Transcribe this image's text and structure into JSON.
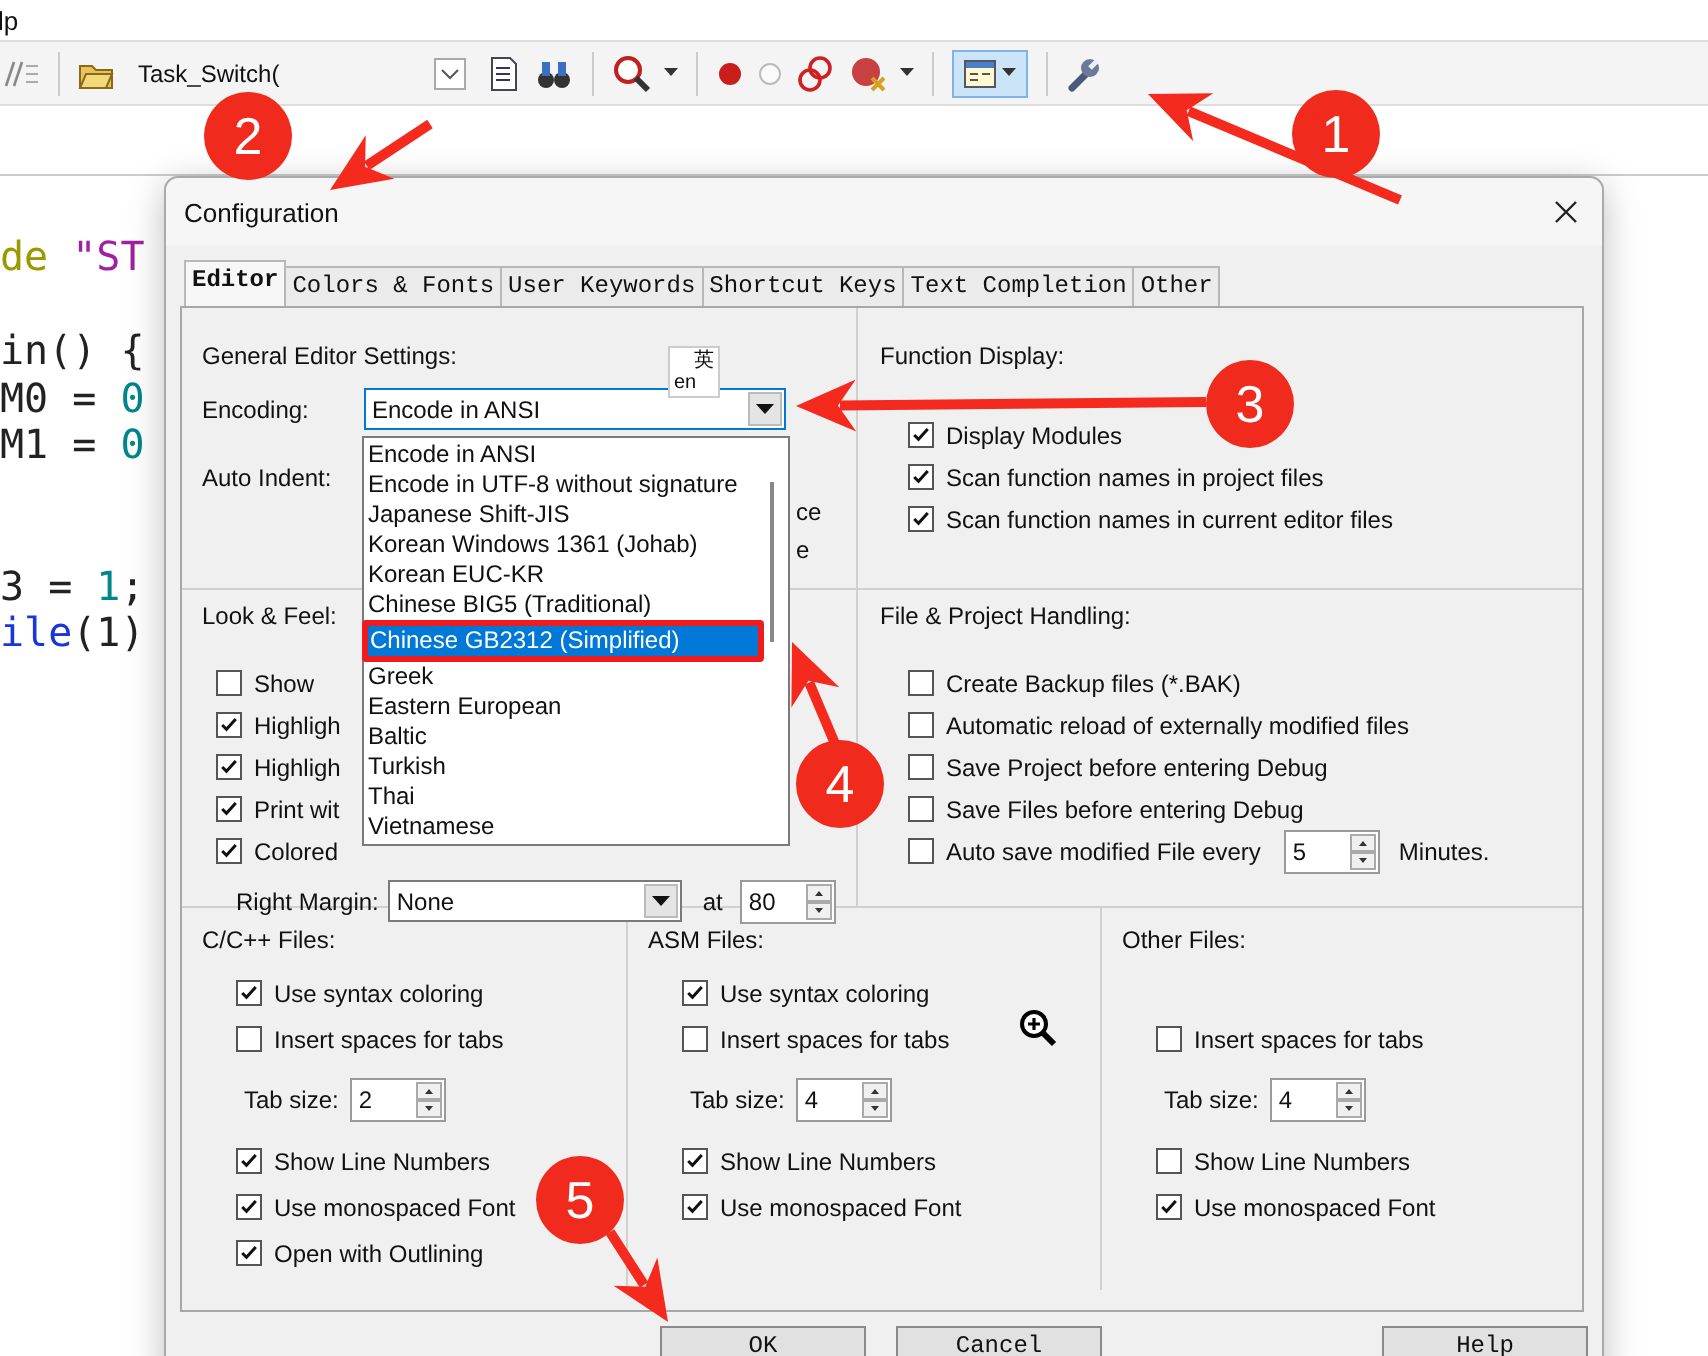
{
  "menu_bar": {
    "text": "lp"
  },
  "toolbar": {
    "target_combo": {
      "value": "Task_Switch("
    },
    "view_button": {
      "selected": true
    }
  },
  "editor": {
    "lines": [
      {
        "kind": "code",
        "segments": [
          {
            "kind": "preprocessor",
            "text": "de"
          },
          {
            "kind": "string",
            "text": " \"ST"
          }
        ]
      },
      {
        "kind": "blank"
      },
      {
        "kind": "code",
        "segments": [
          {
            "kind": "plain",
            "text": "in() {"
          }
        ]
      },
      {
        "kind": "code",
        "segments": [
          {
            "kind": "plain",
            "text": "M0 = "
          },
          {
            "kind": "number",
            "text": "0"
          }
        ]
      },
      {
        "kind": "code",
        "segments": [
          {
            "kind": "plain",
            "text": "M1 = "
          },
          {
            "kind": "number",
            "text": "0"
          }
        ]
      },
      {
        "kind": "blank"
      },
      {
        "kind": "blank"
      },
      {
        "kind": "code",
        "segments": [
          {
            "kind": "plain",
            "text": "3 = "
          },
          {
            "kind": "number",
            "text": "1"
          },
          {
            "kind": "plain",
            "text": ";"
          }
        ]
      },
      {
        "kind": "code",
        "segments": [
          {
            "kind": "keyword",
            "text": "ile"
          },
          {
            "kind": "plain",
            "text": "(1)"
          }
        ]
      }
    ]
  },
  "dialog": {
    "title": "Configuration",
    "tabs": [
      {
        "label": "Editor",
        "selected": true
      },
      {
        "label": "Colors & Fonts",
        "selected": false
      },
      {
        "label": "User Keywords",
        "selected": false
      },
      {
        "label": "Shortcut Keys",
        "selected": false
      },
      {
        "label": "Text Completion",
        "selected": false
      },
      {
        "label": "Other",
        "selected": false
      }
    ],
    "ime_indicator": {
      "glyph": "英",
      "latin": "en"
    },
    "general": {
      "heading": "General Editor Settings:",
      "encoding_label": "Encoding:",
      "encoding_value": "Encode in ANSI",
      "expanded": true,
      "options": [
        {
          "label": "Encode in ANSI",
          "selected": false
        },
        {
          "label": "Encode in UTF-8 without signature",
          "selected": false
        },
        {
          "label": "Japanese Shift-JIS",
          "selected": false
        },
        {
          "label": "Korean Windows 1361 (Johab)",
          "selected": false
        },
        {
          "label": "Korean EUC-KR",
          "selected": false
        },
        {
          "label": "Chinese BIG5 (Traditional)",
          "selected": false
        },
        {
          "label": "Chinese GB2312 (Simplified)",
          "selected": true
        },
        {
          "label": "Greek",
          "selected": false
        },
        {
          "label": "Eastern European",
          "selected": false
        },
        {
          "label": "Baltic",
          "selected": false
        },
        {
          "label": "Turkish",
          "selected": false
        },
        {
          "label": "Thai",
          "selected": false
        },
        {
          "label": "Vietnamese",
          "selected": false
        }
      ],
      "auto_indent_label": "Auto Indent:",
      "hidden_fragments": [
        "ce",
        "e"
      ]
    },
    "function_display": {
      "heading": "Function Display:",
      "options": [
        {
          "label": "Display Modules",
          "checked": true
        },
        {
          "label": "Scan function names in project files",
          "checked": true
        },
        {
          "label": "Scan function names in current editor files",
          "checked": true
        }
      ]
    },
    "look_feel": {
      "heading": "Look & Feel:",
      "options": [
        {
          "label": "Show",
          "checked": false
        },
        {
          "label": "Highligh",
          "checked": true
        },
        {
          "label": "Highligh",
          "checked": true
        },
        {
          "label": "Print wit",
          "checked": true
        },
        {
          "label": "Colored",
          "checked": true
        }
      ],
      "right_margin_label": "Right Margin:",
      "right_margin_value": "None",
      "at_label": "at",
      "column": "80"
    },
    "file_project": {
      "heading": "File & Project Handling:",
      "options": [
        {
          "kind": "checkbox",
          "label": "Create Backup files (*.BAK)",
          "checked": false
        },
        {
          "kind": "checkbox",
          "label": "Automatic reload of externally modified files",
          "checked": false
        },
        {
          "kind": "checkbox",
          "label": "Save Project before entering Debug",
          "checked": false
        },
        {
          "kind": "checkbox",
          "label": "Save Files before entering Debug",
          "checked": false
        },
        {
          "kind": "autosave",
          "label": "Auto save modified File every",
          "checked": false,
          "minutes": "5",
          "unit": "Minutes."
        }
      ]
    },
    "file_types": [
      {
        "heading": "C/C++ Files:",
        "options": [
          {
            "kind": "checkbox",
            "label": "Use syntax coloring",
            "checked": true
          },
          {
            "kind": "checkbox",
            "label": "Insert spaces for tabs",
            "checked": false
          },
          {
            "kind": "tab_size",
            "label": "Tab size:",
            "value": "2"
          },
          {
            "kind": "checkbox",
            "label": "Show Line Numbers",
            "checked": true
          },
          {
            "kind": "checkbox",
            "label": "Use monospaced Font",
            "checked": true
          },
          {
            "kind": "checkbox",
            "label": "Open with Outlining",
            "checked": true
          }
        ]
      },
      {
        "heading": "ASM Files:",
        "options": [
          {
            "kind": "checkbox",
            "label": "Use syntax coloring",
            "checked": true
          },
          {
            "kind": "checkbox",
            "label": "Insert spaces for tabs",
            "checked": false
          },
          {
            "kind": "tab_size",
            "label": "Tab size:",
            "value": "4"
          },
          {
            "kind": "checkbox",
            "label": "Show Line Numbers",
            "checked": true
          },
          {
            "kind": "checkbox",
            "label": "Use monospaced Font",
            "checked": true
          }
        ]
      },
      {
        "heading": "Other Files:",
        "options": [
          {
            "kind": "spacer"
          },
          {
            "kind": "checkbox",
            "label": "Insert spaces for tabs",
            "checked": false
          },
          {
            "kind": "tab_size",
            "label": "Tab size:",
            "value": "4"
          },
          {
            "kind": "checkbox",
            "label": "Show Line Numbers",
            "checked": false
          },
          {
            "kind": "checkbox",
            "label": "Use monospaced Font",
            "checked": true
          }
        ]
      }
    ],
    "buttons": [
      {
        "label": "OK"
      },
      {
        "label": "Cancel"
      },
      {
        "label": "Help"
      }
    ]
  },
  "annotations": [
    {
      "label": "1"
    },
    {
      "label": "2"
    },
    {
      "label": "3"
    },
    {
      "label": "4"
    },
    {
      "label": "5"
    }
  ]
}
